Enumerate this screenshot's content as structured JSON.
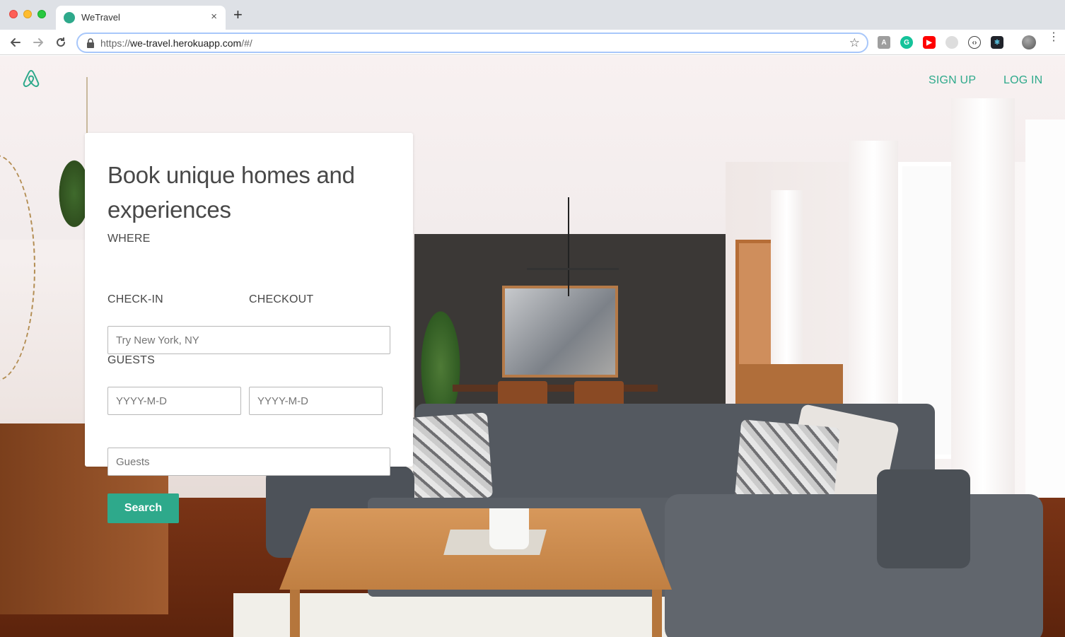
{
  "browser": {
    "tab_title": "WeTravel",
    "tab_close": "×",
    "new_tab": "+",
    "url_scheme": "https://",
    "url_host": "we-travel.herokuapp.com",
    "url_path": "/#/",
    "bookmark_star": "☆",
    "extensions": [
      "pdf-extension-icon",
      "grammarly-icon",
      "youtube-icon",
      "cookie-extension-icon",
      "code-extension-icon",
      "react-devtools-icon"
    ],
    "menu": "⋮"
  },
  "header": {
    "signup_label": "SIGN UP",
    "login_label": "LOG IN",
    "accent_color": "#2ea98b"
  },
  "search_card": {
    "title": "Book unique homes and experiences",
    "where_label": "WHERE",
    "where_placeholder": "Try New York, NY",
    "checkin_label": "CHECK-IN",
    "checkin_placeholder": "YYYY-M-D",
    "checkout_label": "CHECKOUT",
    "checkout_placeholder": "YYYY-M-D",
    "guests_label": "GUESTS",
    "guests_placeholder": "Guests",
    "search_button": "Search"
  }
}
